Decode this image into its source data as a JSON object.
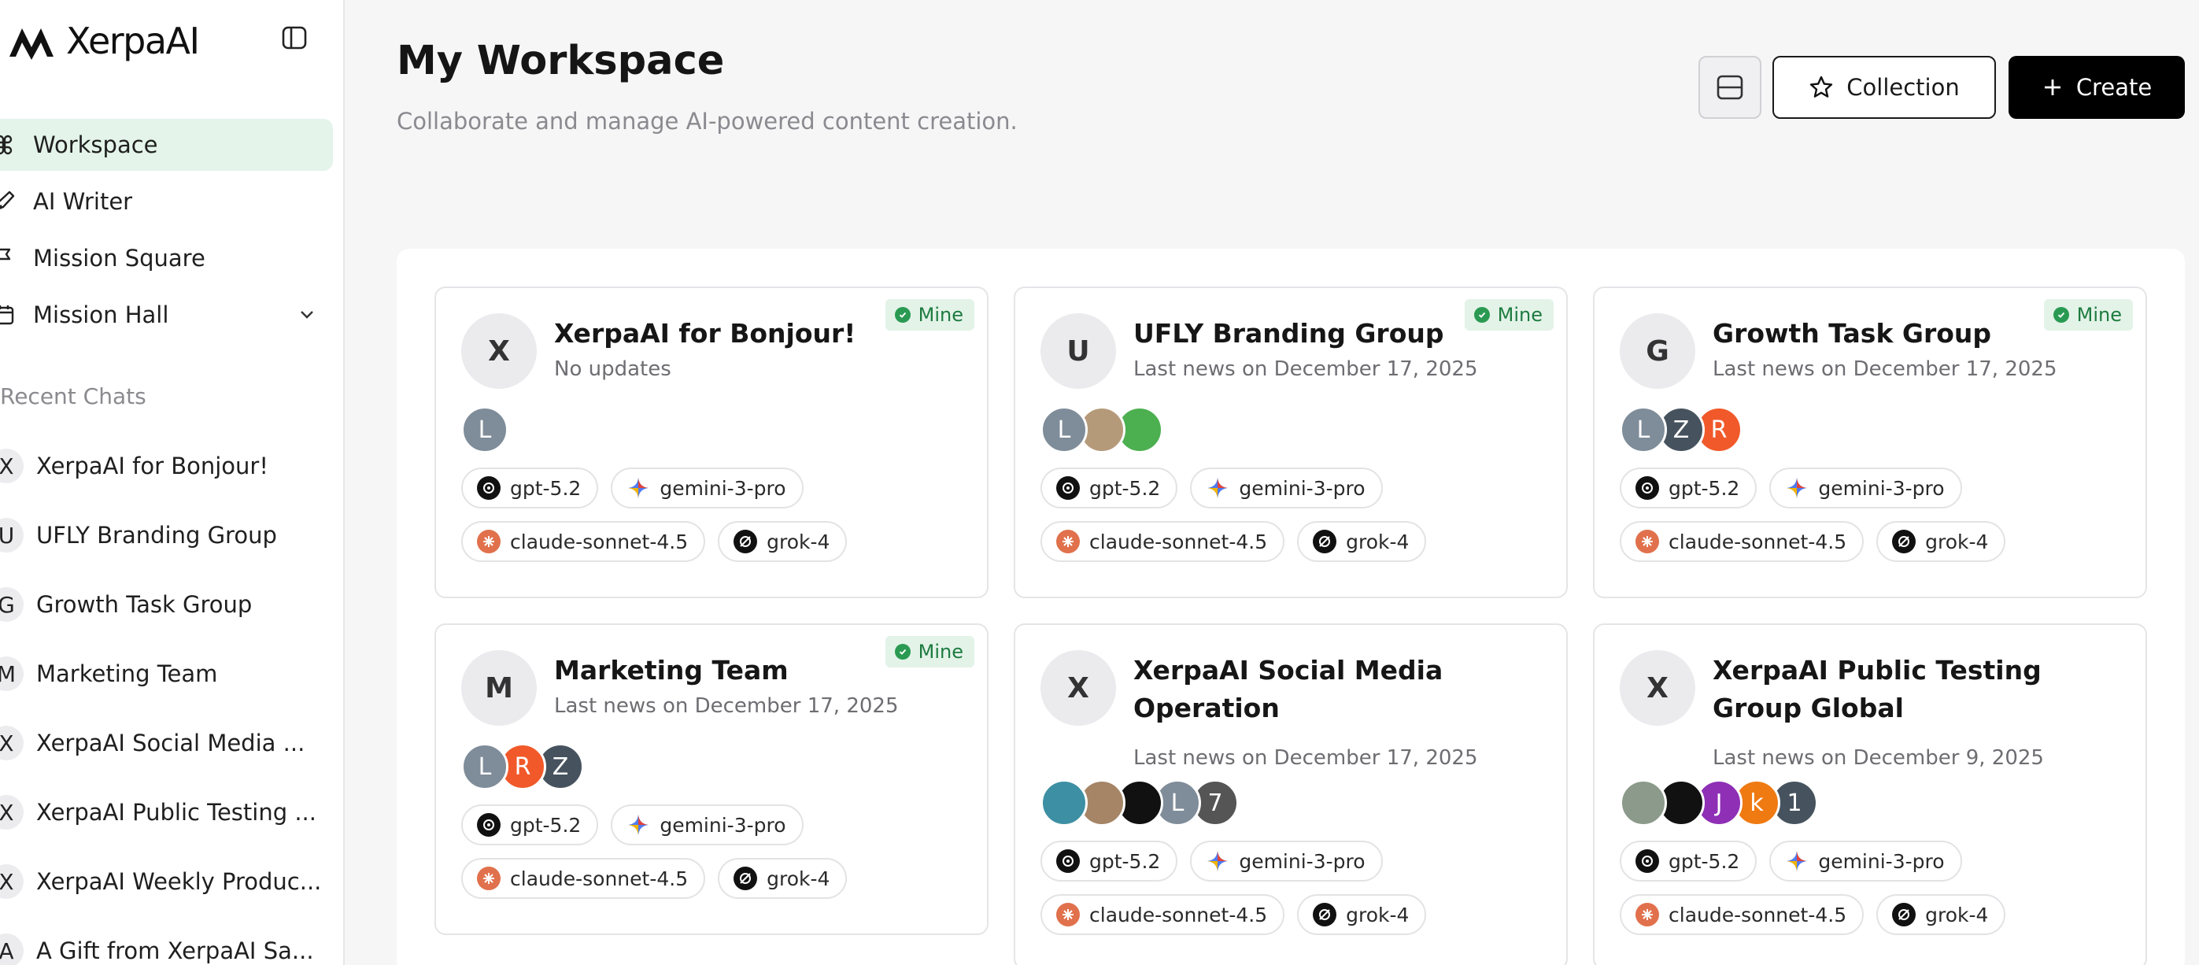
{
  "app": {
    "logo_text": "XerpaAI"
  },
  "sidebar": {
    "nav": [
      {
        "label": "Workspace",
        "icon": "command-icon",
        "active": true
      },
      {
        "label": "AI Writer",
        "icon": "pen-icon",
        "active": false
      },
      {
        "label": "Mission Square",
        "icon": "flag-icon",
        "active": false
      },
      {
        "label": "Mission Hall",
        "icon": "calendar-icon",
        "active": false
      }
    ],
    "recent_label": "Recent Chats",
    "chats": [
      {
        "initial": "X",
        "label": "XerpaAI for Bonjour!"
      },
      {
        "initial": "U",
        "label": "UFLY Branding Group"
      },
      {
        "initial": "G",
        "label": "Growth Task Group"
      },
      {
        "initial": "M",
        "label": "Marketing Team"
      },
      {
        "initial": "X",
        "label": "XerpaAI Social Media ..."
      },
      {
        "initial": "X",
        "label": "XerpaAI Public Testing ..."
      },
      {
        "initial": "X",
        "label": "XerpaAI Weekly Produc..."
      },
      {
        "initial": "A",
        "label": "A Gift from XerpaAI Sa..."
      }
    ]
  },
  "header": {
    "title": "My Workspace",
    "subtitle": "Collaborate and manage AI-powered content creation.",
    "collection_label": "Collection",
    "create_label": "Create"
  },
  "badge_label": "Mine",
  "models": [
    "gpt-5.2",
    "gemini-3-pro",
    "claude-sonnet-4.5",
    "grok-4"
  ],
  "cards": [
    {
      "initial": "X",
      "title": "XerpaAI for Bonjour!",
      "subtitle": "No updates",
      "mine": true,
      "members": [
        {
          "letter": "L",
          "color": "#7f8c99"
        }
      ]
    },
    {
      "initial": "U",
      "title": "UFLY Branding Group",
      "subtitle": "Last news on December 17, 2025",
      "mine": true,
      "members": [
        {
          "letter": "L",
          "color": "#7f8c99"
        },
        {
          "letter": "",
          "color": "#b59a7a"
        },
        {
          "letter": "",
          "color": "#4caf50"
        }
      ]
    },
    {
      "initial": "G",
      "title": "Growth Task Group",
      "subtitle": "Last news on December 17, 2025",
      "mine": true,
      "members": [
        {
          "letter": "L",
          "color": "#7f8c99"
        },
        {
          "letter": "Z",
          "color": "#46535e"
        },
        {
          "letter": "R",
          "color": "#f1592a"
        }
      ]
    },
    {
      "initial": "M",
      "title": "Marketing Team",
      "subtitle": "Last news on December 17, 2025",
      "mine": true,
      "members": [
        {
          "letter": "L",
          "color": "#7f8c99"
        },
        {
          "letter": "R",
          "color": "#f1592a"
        },
        {
          "letter": "Z",
          "color": "#46535e"
        }
      ]
    },
    {
      "initial": "X",
      "title": "XerpaAI Social Media Operation",
      "subtitle": "Last news on December 17, 2025",
      "mine": false,
      "members": [
        {
          "letter": "",
          "color": "#3d8fa3"
        },
        {
          "letter": "",
          "color": "#a58566"
        },
        {
          "letter": "",
          "color": "#111111"
        },
        {
          "letter": "L",
          "color": "#7f8c99"
        },
        {
          "letter": "7",
          "color": "#555555"
        }
      ]
    },
    {
      "initial": "X",
      "title": "XerpaAI Public Testing Group Global",
      "subtitle": "Last news on December 9, 2025",
      "mine": false,
      "members": [
        {
          "letter": "",
          "color": "#8b9a8a"
        },
        {
          "letter": "",
          "color": "#111111"
        },
        {
          "letter": "J",
          "color": "#8e2fb5"
        },
        {
          "letter": "k",
          "color": "#ef7a12"
        },
        {
          "letter": "1",
          "color": "#46535e"
        }
      ]
    }
  ]
}
